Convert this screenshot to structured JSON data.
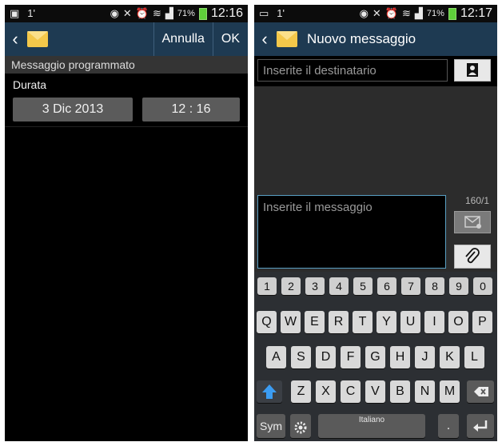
{
  "statusbar": {
    "left_text": "1'",
    "battery_pct": "71%",
    "time_left": "12:16",
    "time_right": "12:17"
  },
  "screen1": {
    "actions": {
      "cancel_label": "Annulla",
      "ok_label": "OK"
    },
    "section_title": "Messaggio programmato",
    "duration_label": "Durata",
    "date_value": "3 Dic 2013",
    "time_value": "12 : 16"
  },
  "screen2": {
    "title": "Nuovo messaggio",
    "recipient_placeholder": "Inserite il destinatario",
    "message_placeholder": "Inserite il messaggio",
    "counter": "160/1",
    "keyboard": {
      "numbers": [
        "1",
        "2",
        "3",
        "4",
        "5",
        "6",
        "7",
        "8",
        "9",
        "0"
      ],
      "row1": [
        "Q",
        "W",
        "E",
        "R",
        "T",
        "Y",
        "U",
        "I",
        "O",
        "P"
      ],
      "row2": [
        "A",
        "S",
        "D",
        "F",
        "G",
        "H",
        "J",
        "K",
        "L"
      ],
      "row3": [
        "Z",
        "X",
        "C",
        "V",
        "B",
        "N",
        "M"
      ],
      "sym_label": "Sym",
      "space_label": "Italiano",
      "dot_label": "."
    }
  },
  "icons": {
    "back": "chevron-left-icon",
    "app": "envelope-icon",
    "contact": "contact-icon",
    "send": "send-icon",
    "attach": "paperclip-icon",
    "shift": "shift-icon",
    "backspace": "backspace-icon",
    "settings": "gear-icon",
    "enter": "enter-icon"
  },
  "colors": {
    "action_bar": "#1e3a52",
    "focus_border": "#5aa0c4",
    "battery": "#5fcf3a",
    "shift_accent": "#3b9cf2"
  }
}
